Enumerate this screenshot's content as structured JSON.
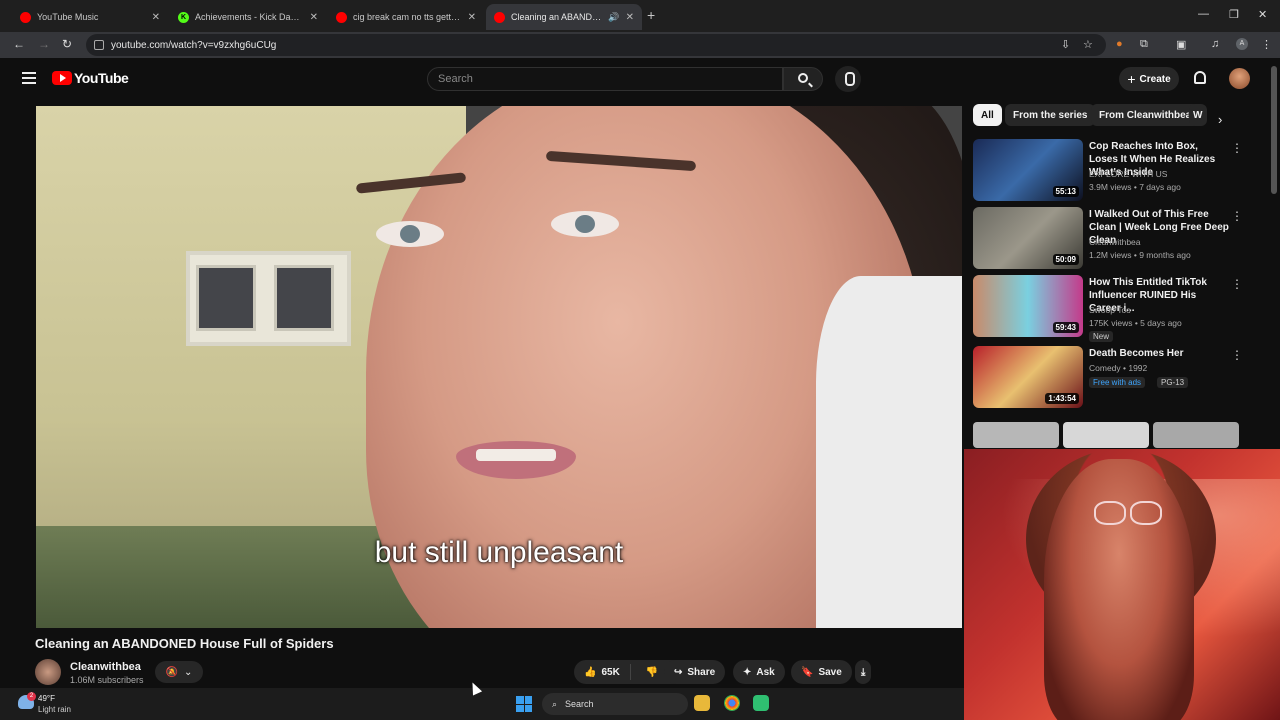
{
  "browser": {
    "tabs": [
      {
        "title": "YouTube Music",
        "favicon_color": "#ff0000"
      },
      {
        "title": "Achievements - Kick Dashboard",
        "favicon_color": "#53fc18"
      },
      {
        "title": "cig break cam no tts getting Ja",
        "favicon_color": "#ff0000"
      },
      {
        "title": "Cleaning an ABANDONED H",
        "favicon_color": "#ff0000",
        "active": true
      }
    ],
    "url": "youtube.com/watch?v=v9zxhg6uCUg"
  },
  "youtube": {
    "logo_text": "YouTube",
    "search_placeholder": "Search",
    "create_label": "Create"
  },
  "video": {
    "caption": "but still unpleasant",
    "title": "Cleaning an ABANDONED House Full of Spiders",
    "channel": "Cleanwithbea",
    "subscribers": "1.06M subscribers",
    "likes": "65K",
    "share_label": "Share",
    "ask_label": "Ask",
    "save_label": "Save"
  },
  "sidebar": {
    "chips": [
      "All",
      "From the series",
      "From Cleanwithbea",
      "W"
    ],
    "recommendations": [
      {
        "title": "Cop Reaches Into Box, Loses It When He Realizes What's Inside",
        "channel": "EXPLORE WITH US",
        "meta": "3.9M views • 7 days ago",
        "duration": "55:13",
        "badge": ""
      },
      {
        "title": "I Walked Out of This Free Clean | Week Long Free Deep Clean",
        "channel": "Cleanwithbea",
        "meta": "1.2M views • 9 months ago",
        "duration": "50:09",
        "badge": ""
      },
      {
        "title": "How This Entitled TikTok Influencer RUINED His Career i...",
        "channel": "Swoop Too",
        "meta": "175K views • 5 days ago",
        "duration": "59:43",
        "badge": "New"
      },
      {
        "title": "Death Becomes Her",
        "channel": "Comedy • 1992",
        "meta": "",
        "duration": "1:43:54",
        "badge": "Free with ads",
        "badge2": "PG-13"
      }
    ]
  },
  "taskbar": {
    "temperature": "49°F",
    "condition": "Light rain",
    "search_label": "Search",
    "notification_count": "2"
  }
}
